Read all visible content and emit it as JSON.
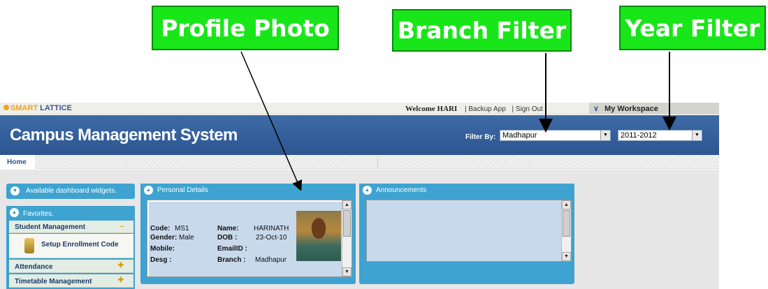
{
  "callouts": {
    "profile_photo": "Profile Photo",
    "branch_filter": "Branch Filter",
    "year_filter": "Year Filter"
  },
  "topbar": {
    "brand_smart": "SMART",
    "brand_lattice": " LATTICE",
    "welcome": "Welcome HARI",
    "backup_link": "| Backup App",
    "signout_link": "| Sign Out",
    "workspace": "My Workspace"
  },
  "header": {
    "title": "Campus Management System",
    "filter_label": "Filter By:",
    "branch_value": "Madhapur",
    "year_value": "2011-2012"
  },
  "breadcrumb": {
    "home": "Home"
  },
  "left": {
    "available_widgets": "Available dashboard widgets.",
    "favorites_title": "Favorites.",
    "items": [
      {
        "label": "Student Management"
      },
      {
        "label": "Setup Enrollment Code"
      },
      {
        "label": "Attendance"
      },
      {
        "label": "Timetable Management"
      }
    ]
  },
  "personal_details": {
    "title": "Personal Details",
    "code_label": "Code:",
    "code_value": "MS1",
    "gender_label": "Gender:",
    "gender_value": "Male",
    "mobile_label": "Mobile:",
    "desg_label": "Desg :",
    "name_label": "Name:",
    "name_value": "HARINATH",
    "dob_label": "DOB :",
    "dob_value": "23-Oct-10",
    "email_label": "EmailID :",
    "branch_label": "Branch :",
    "branch_value": "Madhapur"
  },
  "announcements": {
    "title": "Announcements"
  },
  "colors": {
    "callout_green": "#19e619",
    "header_blue": "#2d5690",
    "panel_blue": "#3ea3d1",
    "panel_body": "#c9d9ec"
  }
}
